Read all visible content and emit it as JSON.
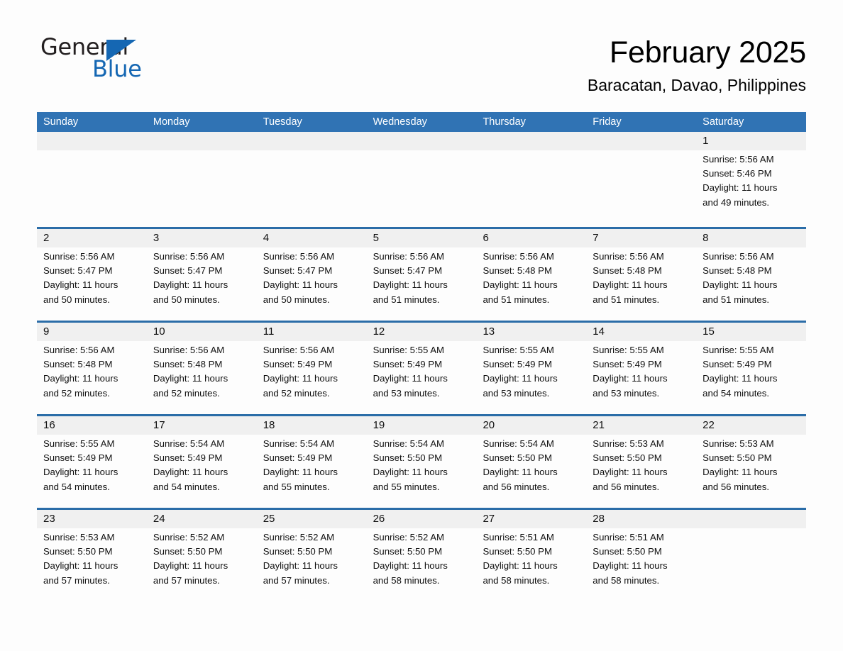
{
  "brand": {
    "name_part1": "General",
    "name_part2": "Blue",
    "triangle_color": "#1567b3",
    "text_color": "#231f20"
  },
  "header": {
    "month_title": "February 2025",
    "location": "Baracatan, Davao, Philippines"
  },
  "theme": {
    "header_blue": "#3073b4",
    "divider_blue": "#2b6da8",
    "daynum_band": "#f0f0f0",
    "page_background": "#fdfdfd"
  },
  "calendar": {
    "weekday_headers": [
      "Sunday",
      "Monday",
      "Tuesday",
      "Wednesday",
      "Thursday",
      "Friday",
      "Saturday"
    ],
    "weeks": [
      [
        {
          "day": "",
          "info": ""
        },
        {
          "day": "",
          "info": ""
        },
        {
          "day": "",
          "info": ""
        },
        {
          "day": "",
          "info": ""
        },
        {
          "day": "",
          "info": ""
        },
        {
          "day": "",
          "info": ""
        },
        {
          "day": "1",
          "info": "Sunrise: 5:56 AM\nSunset: 5:46 PM\nDaylight: 11 hours\nand 49 minutes."
        }
      ],
      [
        {
          "day": "2",
          "info": "Sunrise: 5:56 AM\nSunset: 5:47 PM\nDaylight: 11 hours\nand 50 minutes."
        },
        {
          "day": "3",
          "info": "Sunrise: 5:56 AM\nSunset: 5:47 PM\nDaylight: 11 hours\nand 50 minutes."
        },
        {
          "day": "4",
          "info": "Sunrise: 5:56 AM\nSunset: 5:47 PM\nDaylight: 11 hours\nand 50 minutes."
        },
        {
          "day": "5",
          "info": "Sunrise: 5:56 AM\nSunset: 5:47 PM\nDaylight: 11 hours\nand 51 minutes."
        },
        {
          "day": "6",
          "info": "Sunrise: 5:56 AM\nSunset: 5:48 PM\nDaylight: 11 hours\nand 51 minutes."
        },
        {
          "day": "7",
          "info": "Sunrise: 5:56 AM\nSunset: 5:48 PM\nDaylight: 11 hours\nand 51 minutes."
        },
        {
          "day": "8",
          "info": "Sunrise: 5:56 AM\nSunset: 5:48 PM\nDaylight: 11 hours\nand 51 minutes."
        }
      ],
      [
        {
          "day": "9",
          "info": "Sunrise: 5:56 AM\nSunset: 5:48 PM\nDaylight: 11 hours\nand 52 minutes."
        },
        {
          "day": "10",
          "info": "Sunrise: 5:56 AM\nSunset: 5:48 PM\nDaylight: 11 hours\nand 52 minutes."
        },
        {
          "day": "11",
          "info": "Sunrise: 5:56 AM\nSunset: 5:49 PM\nDaylight: 11 hours\nand 52 minutes."
        },
        {
          "day": "12",
          "info": "Sunrise: 5:55 AM\nSunset: 5:49 PM\nDaylight: 11 hours\nand 53 minutes."
        },
        {
          "day": "13",
          "info": "Sunrise: 5:55 AM\nSunset: 5:49 PM\nDaylight: 11 hours\nand 53 minutes."
        },
        {
          "day": "14",
          "info": "Sunrise: 5:55 AM\nSunset: 5:49 PM\nDaylight: 11 hours\nand 53 minutes."
        },
        {
          "day": "15",
          "info": "Sunrise: 5:55 AM\nSunset: 5:49 PM\nDaylight: 11 hours\nand 54 minutes."
        }
      ],
      [
        {
          "day": "16",
          "info": "Sunrise: 5:55 AM\nSunset: 5:49 PM\nDaylight: 11 hours\nand 54 minutes."
        },
        {
          "day": "17",
          "info": "Sunrise: 5:54 AM\nSunset: 5:49 PM\nDaylight: 11 hours\nand 54 minutes."
        },
        {
          "day": "18",
          "info": "Sunrise: 5:54 AM\nSunset: 5:49 PM\nDaylight: 11 hours\nand 55 minutes."
        },
        {
          "day": "19",
          "info": "Sunrise: 5:54 AM\nSunset: 5:50 PM\nDaylight: 11 hours\nand 55 minutes."
        },
        {
          "day": "20",
          "info": "Sunrise: 5:54 AM\nSunset: 5:50 PM\nDaylight: 11 hours\nand 56 minutes."
        },
        {
          "day": "21",
          "info": "Sunrise: 5:53 AM\nSunset: 5:50 PM\nDaylight: 11 hours\nand 56 minutes."
        },
        {
          "day": "22",
          "info": "Sunrise: 5:53 AM\nSunset: 5:50 PM\nDaylight: 11 hours\nand 56 minutes."
        }
      ],
      [
        {
          "day": "23",
          "info": "Sunrise: 5:53 AM\nSunset: 5:50 PM\nDaylight: 11 hours\nand 57 minutes."
        },
        {
          "day": "24",
          "info": "Sunrise: 5:52 AM\nSunset: 5:50 PM\nDaylight: 11 hours\nand 57 minutes."
        },
        {
          "day": "25",
          "info": "Sunrise: 5:52 AM\nSunset: 5:50 PM\nDaylight: 11 hours\nand 57 minutes."
        },
        {
          "day": "26",
          "info": "Sunrise: 5:52 AM\nSunset: 5:50 PM\nDaylight: 11 hours\nand 58 minutes."
        },
        {
          "day": "27",
          "info": "Sunrise: 5:51 AM\nSunset: 5:50 PM\nDaylight: 11 hours\nand 58 minutes."
        },
        {
          "day": "28",
          "info": "Sunrise: 5:51 AM\nSunset: 5:50 PM\nDaylight: 11 hours\nand 58 minutes."
        },
        {
          "day": "",
          "info": ""
        }
      ]
    ]
  }
}
